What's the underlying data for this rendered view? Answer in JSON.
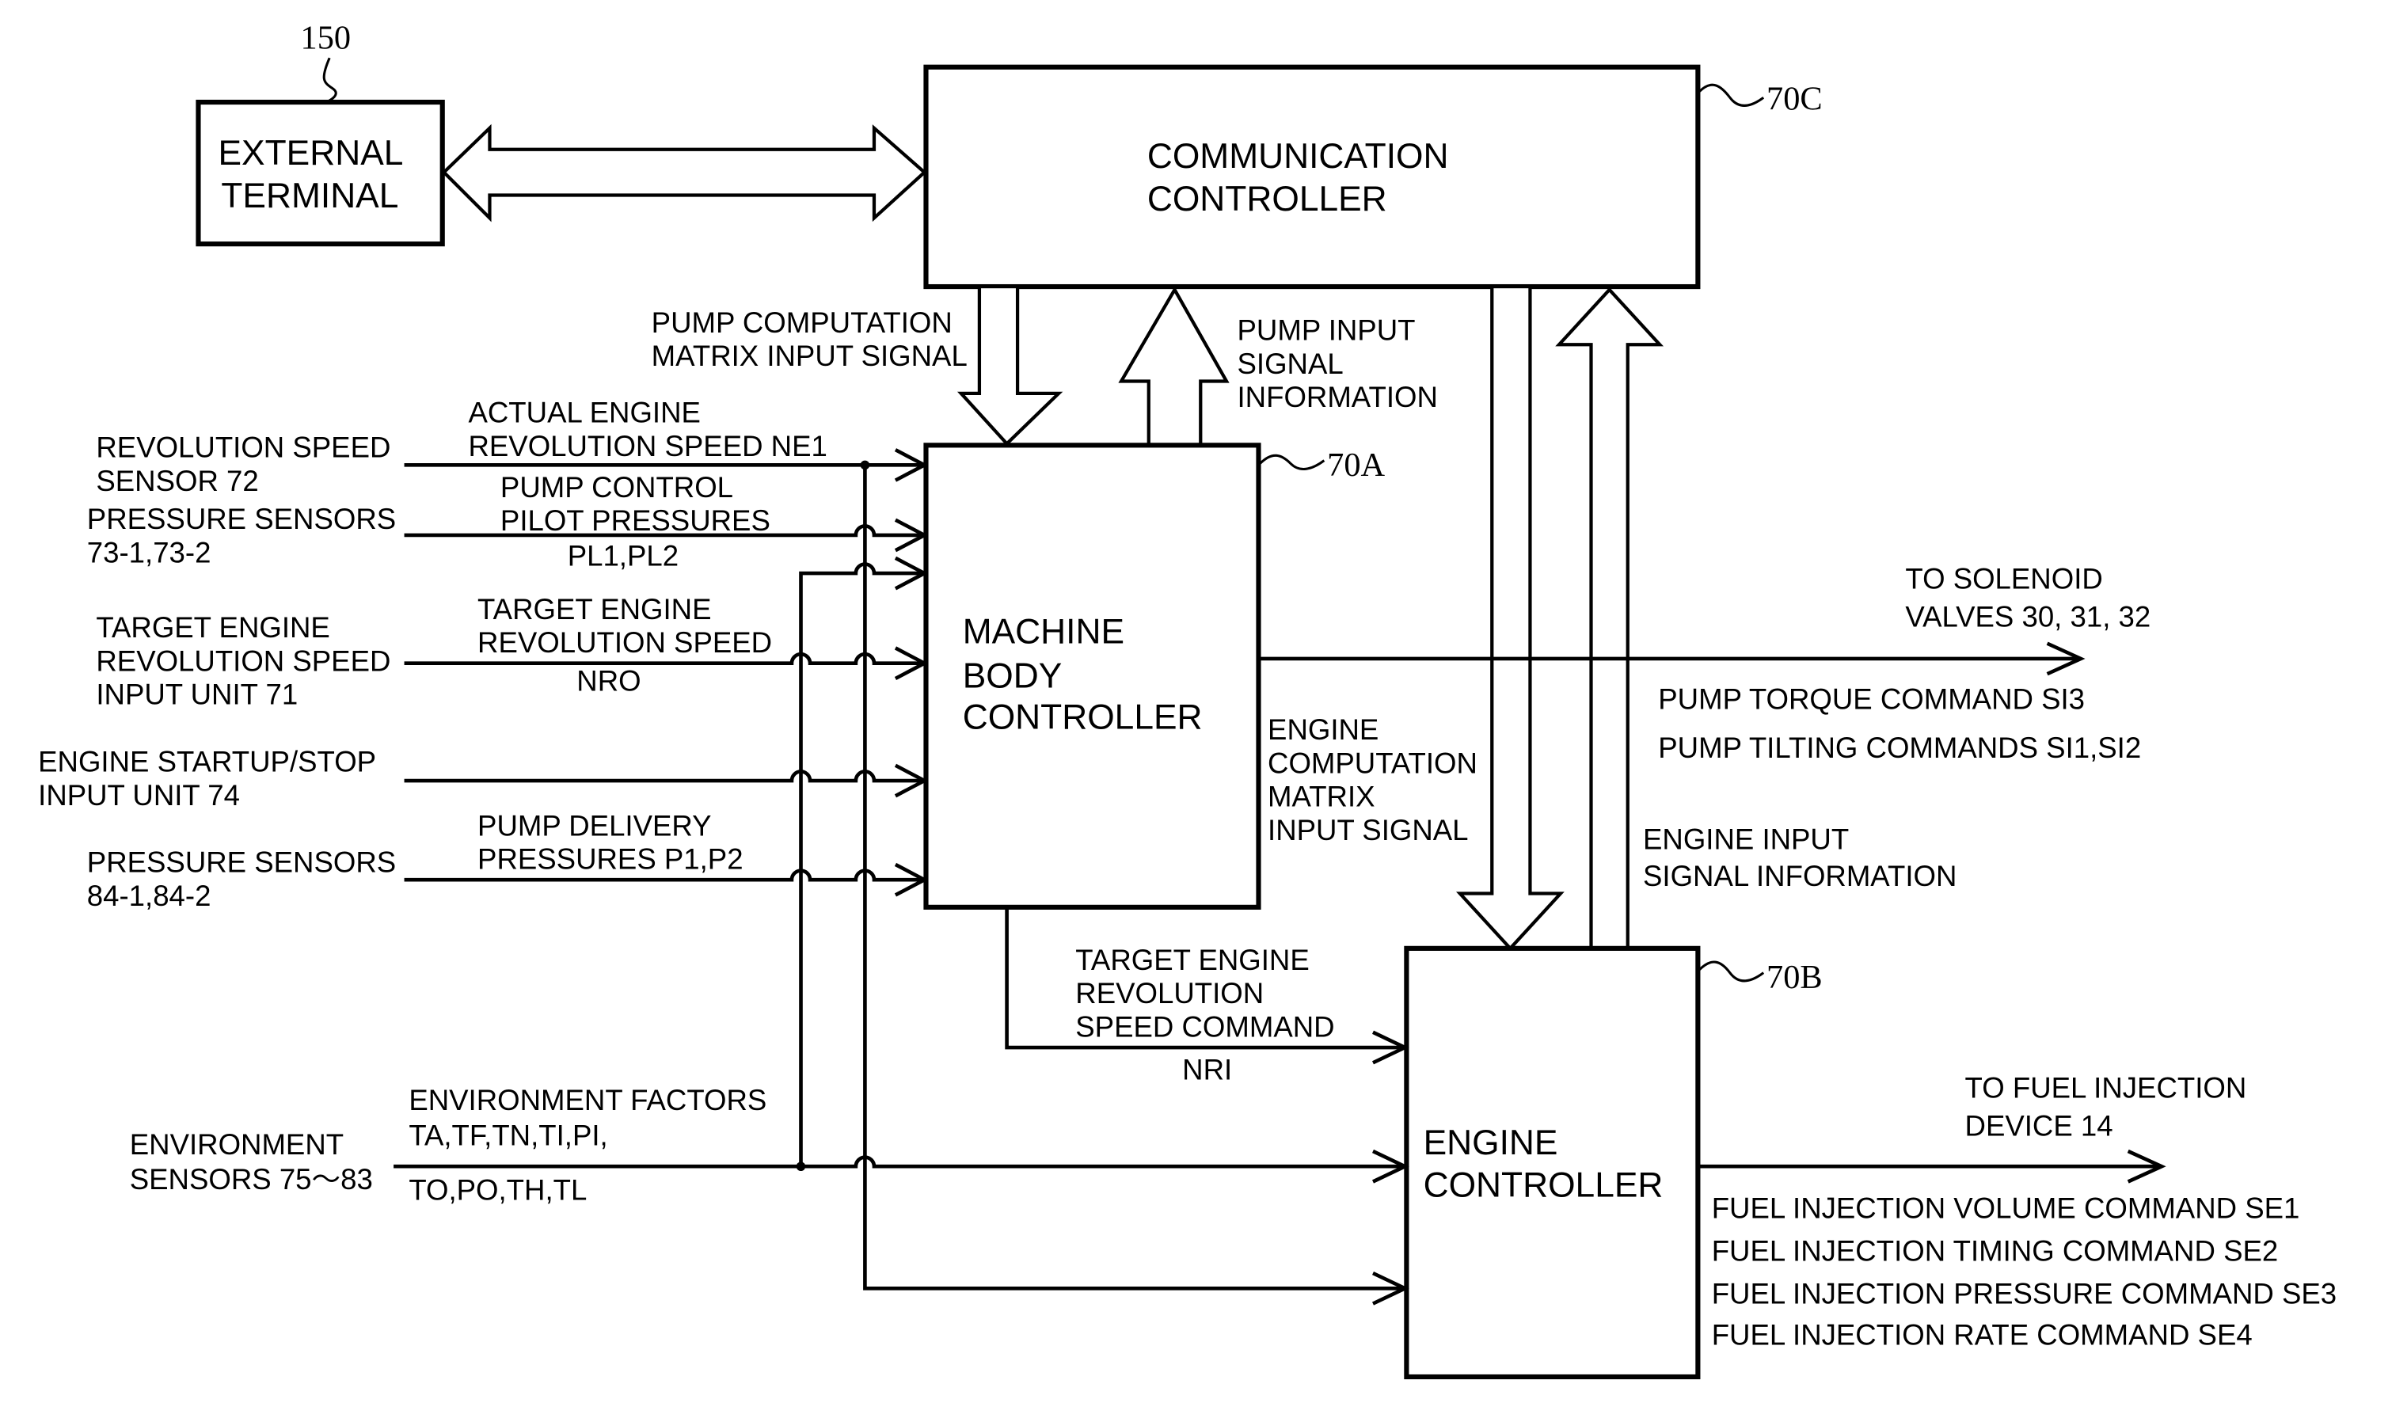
{
  "figure": {
    "blocks": {
      "external_terminal": {
        "ref": "150",
        "lines": [
          "EXTERNAL",
          "TERMINAL"
        ]
      },
      "communication_controller": {
        "ref": "70C",
        "lines": [
          "COMMUNICATION",
          "CONTROLLER"
        ]
      },
      "machine_body_controller": {
        "ref": "70A",
        "lines": [
          "MACHINE",
          "BODY",
          "CONTROLLER"
        ]
      },
      "engine_controller": {
        "ref": "70B",
        "lines": [
          "ENGINE",
          "CONTROLLER"
        ]
      }
    },
    "bus_labels": {
      "pump_computation": [
        "PUMP COMPUTATION",
        "MATRIX INPUT SIGNAL"
      ],
      "pump_input": [
        "PUMP INPUT",
        "SIGNAL",
        "INFORMATION"
      ],
      "engine_computation": [
        "ENGINE",
        "COMPUTATION",
        "MATRIX",
        "INPUT SIGNAL"
      ],
      "engine_input": [
        "ENGINE INPUT",
        "SIGNAL INFORMATION"
      ]
    },
    "sources": {
      "revolution_speed_sensor": [
        "REVOLUTION SPEED",
        "SENSOR 72"
      ],
      "pressure_sensors_73": [
        "PRESSURE SENSORS",
        "73-1,73-2"
      ],
      "target_engine_input": [
        "TARGET ENGINE",
        "REVOLUTION SPEED",
        "INPUT UNIT 71"
      ],
      "engine_startup_stop": [
        "ENGINE STARTUP/STOP",
        "INPUT UNIT 74"
      ],
      "pressure_sensors_84": [
        "PRESSURE SENSORS",
        "84-1,84-2"
      ],
      "environment_sensors": [
        "ENVIRONMENT",
        "SENSORS 75～83"
      ]
    },
    "signals": {
      "actual_engine_speed": [
        "ACTUAL ENGINE",
        "REVOLUTION SPEED NE1"
      ],
      "pump_control_pilot": [
        "PUMP CONTROL",
        "PILOT PRESSURES"
      ],
      "pump_control_pilot_sub": "PL1,PL2",
      "target_engine_speed": [
        "TARGET ENGINE",
        "REVOLUTION SPEED"
      ],
      "target_engine_speed_sub": "NRO",
      "pump_delivery": [
        "PUMP DELIVERY",
        "PRESSURES P1,P2"
      ],
      "environment_factors": [
        "ENVIRONMENT FACTORS",
        "TA,TF,TN,TI,PI,"
      ],
      "environment_factors_sub": "TO,PO,TH,TL",
      "target_speed_command": [
        "TARGET ENGINE",
        "REVOLUTION",
        "SPEED COMMAND"
      ],
      "target_speed_command_sub": "NRI"
    },
    "outputs": {
      "solenoid": {
        "destination": [
          "TO SOLENOID",
          "VALVES 30, 31, 32"
        ],
        "commands": [
          "PUMP TORQUE COMMAND SI3",
          "PUMP TILTING COMMANDS SI1,SI2"
        ]
      },
      "fuel_injection": {
        "destination": [
          "TO FUEL INJECTION",
          "DEVICE 14"
        ],
        "commands": [
          "FUEL INJECTION VOLUME COMMAND SE1",
          "FUEL INJECTION TIMING COMMAND SE2",
          "FUEL INJECTION PRESSURE COMMAND SE3",
          "FUEL INJECTION RATE COMMAND SE4"
        ]
      }
    }
  }
}
